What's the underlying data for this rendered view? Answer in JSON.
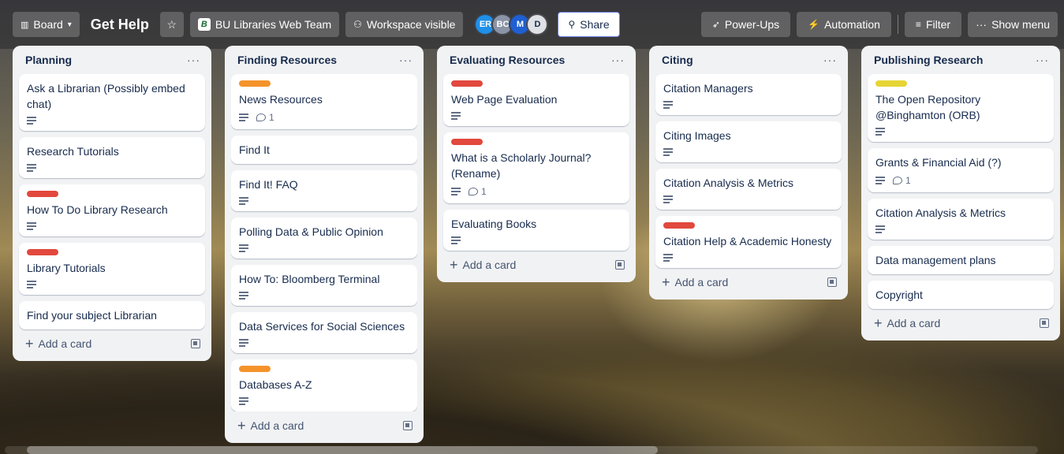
{
  "header": {
    "view_label": "Board",
    "board_title": "Get Help",
    "workspace": "BU Libraries Web Team",
    "visibility": "Workspace visible",
    "avatars": [
      {
        "initials": "ER",
        "color": "#1f8fe8"
      },
      {
        "initials": "BC",
        "color": "#8a94a6"
      },
      {
        "initials": "M",
        "color": "#1f5fd1"
      },
      {
        "initials": "D",
        "color": "#dfe1e6"
      }
    ],
    "share_label": "Share",
    "power_ups": "Power-Ups",
    "automation": "Automation",
    "filter": "Filter",
    "show_menu": "Show menu"
  },
  "lists": [
    {
      "title": "Planning",
      "add_label": "Add a card",
      "cards": [
        {
          "title": "Ask a Librarian (Possibly embed chat)",
          "desc": true
        },
        {
          "title": "Research Tutorials",
          "desc": true
        },
        {
          "title": "How To Do Library Research",
          "label": "#e2483d",
          "desc": true
        },
        {
          "title": "Library Tutorials",
          "label": "#e2483d",
          "desc": true
        },
        {
          "title": "Find your subject Librarian"
        }
      ]
    },
    {
      "title": "Finding Resources",
      "add_label": "Add a card",
      "cards": [
        {
          "title": "News Resources",
          "label": "#f5932b",
          "desc": true,
          "comments": "1"
        },
        {
          "title": "Find It"
        },
        {
          "title": "Find It! FAQ",
          "desc": true
        },
        {
          "title": "Polling Data & Public Opinion",
          "desc": true
        },
        {
          "title": "How To: Bloomberg Terminal",
          "desc": true
        },
        {
          "title": "Data Services for Social Sciences",
          "desc": true
        },
        {
          "title": "Databases A-Z",
          "label": "#f5932b",
          "desc": true
        }
      ]
    },
    {
      "title": "Evaluating Resources",
      "add_label": "Add a card",
      "cards": [
        {
          "title": "Web Page Evaluation",
          "label": "#e2483d",
          "desc": true
        },
        {
          "title": "What is a Scholarly Journal? (Rename)",
          "label": "#e2483d",
          "desc": true,
          "comments": "1"
        },
        {
          "title": "Evaluating Books",
          "desc": true
        }
      ]
    },
    {
      "title": "Citing",
      "add_label": "Add a card",
      "cards": [
        {
          "title": "Citation Managers",
          "desc": true
        },
        {
          "title": "Citing Images",
          "desc": true
        },
        {
          "title": "Citation Analysis & Metrics",
          "desc": true
        },
        {
          "title": "Citation Help & Academic Honesty",
          "label": "#e2483d",
          "desc": true
        }
      ]
    },
    {
      "title": "Publishing Research",
      "add_label": "Add a card",
      "cards": [
        {
          "title": "The Open Repository @Binghamton (ORB)",
          "label": "#e7d535",
          "desc": true
        },
        {
          "title": "Grants & Financial Aid (?)",
          "desc": true,
          "comments": "1"
        },
        {
          "title": "Citation Analysis & Metrics",
          "desc": true
        },
        {
          "title": "Data management plans"
        },
        {
          "title": "Copyright"
        }
      ]
    }
  ]
}
